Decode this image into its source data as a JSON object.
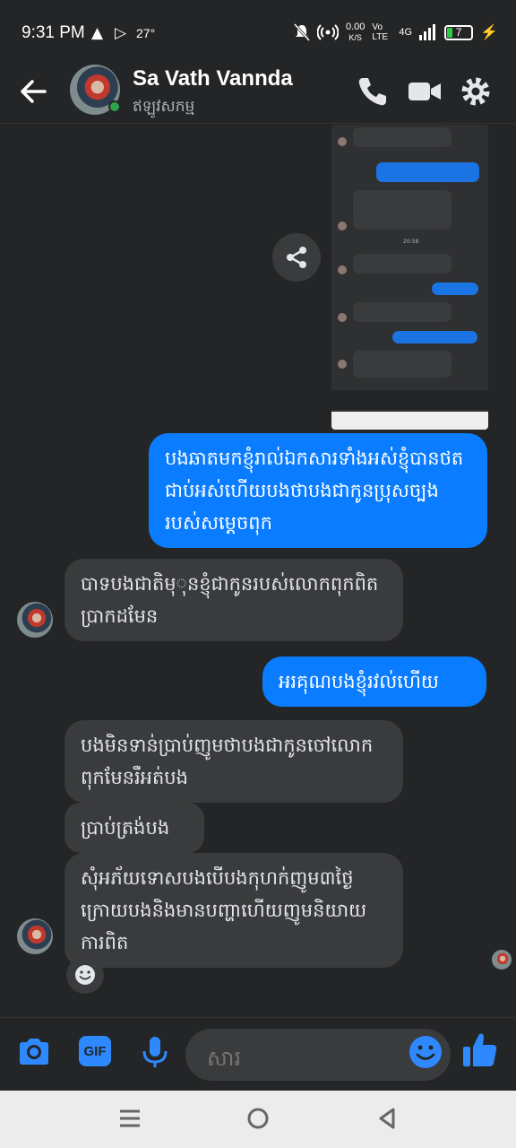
{
  "status_bar": {
    "time": "9:31 PM",
    "temperature": "27°",
    "net_speed_value": "0.00",
    "net_speed_unit": "K/S",
    "volte": "Vo LTE",
    "network": "4G",
    "battery": "7"
  },
  "header": {
    "contact_name": "Sa Vath Vannda",
    "status": "ឥឡូវសកម្ម"
  },
  "messages": [
    {
      "direction": "out",
      "text": "បងឆាតមកខ្ញុំរាល់ឯកសារទាំងអស់ខ្ញុំបានថតជាប់អស់ហើយបងថាបងជាកូនប្រុសច្បងរបស់សម្តេចពុក"
    },
    {
      "direction": "in",
      "text": "បាទបងជាតិមុុនខ្ញុំជាកូនរបស់លោកពុកពិតប្រាកដមែន"
    },
    {
      "direction": "out",
      "text": "អរគុណបងខ្ញុំរវល់ហើយ"
    },
    {
      "direction": "in",
      "text": "បងមិនទាន់ប្រាប់ញូមថាបងជាកូនចៅលោកពុកមែនរឺអត់បង"
    },
    {
      "direction": "in",
      "text": "ប្រាប់ត្រង់បង"
    },
    {
      "direction": "in",
      "text": "សុំអភ័យទោសបងបើបងកុហក់ញូម៣ថ្ងៃក្រោយបងនិងមានបញ្ហាហើយញូមនិយាយការពិត"
    }
  ],
  "composer": {
    "gif_label": "GIF",
    "placeholder": "សារ"
  },
  "colors": {
    "background": "#242526",
    "outgoing_bubble": "#0a7cff",
    "incoming_bubble": "#3a3b3c",
    "accent": "#2e89ff",
    "online": "#31a24c"
  },
  "icons": [
    "back-arrow-icon",
    "phone-icon",
    "video-camera-icon",
    "settings-icon",
    "share-icon",
    "smile-reaction-icon",
    "camera-icon",
    "gif-icon",
    "microphone-icon",
    "emoji-icon",
    "thumbs-up-icon",
    "recents-icon",
    "home-icon",
    "back-triangle-icon"
  ]
}
